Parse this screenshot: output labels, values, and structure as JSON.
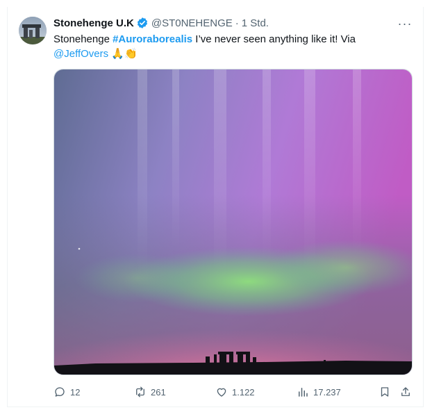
{
  "tweet": {
    "display_name": "Stonehenge U.K",
    "handle": "@ST0NEHENGE",
    "separator": "·",
    "time": "1 Std.",
    "text_prefix": "Stonehenge ",
    "hashtag": "#Auroraborealis",
    "text_middle": " I’ve never seen anything like it!  Via ",
    "mention": "@JeffOvers",
    "emojis": "🙏👏",
    "more_label": "···"
  },
  "actions": {
    "replies": "12",
    "reposts": "261",
    "likes": "1.122",
    "views": "17.237"
  },
  "icons": {
    "verified": "verified-badge-icon",
    "reply": "reply-icon",
    "repost": "repost-icon",
    "like": "like-icon",
    "views": "views-icon",
    "bookmark": "bookmark-icon",
    "share": "share-icon"
  },
  "colors": {
    "accent": "#1d9bf0",
    "secondary_text": "#536471"
  }
}
